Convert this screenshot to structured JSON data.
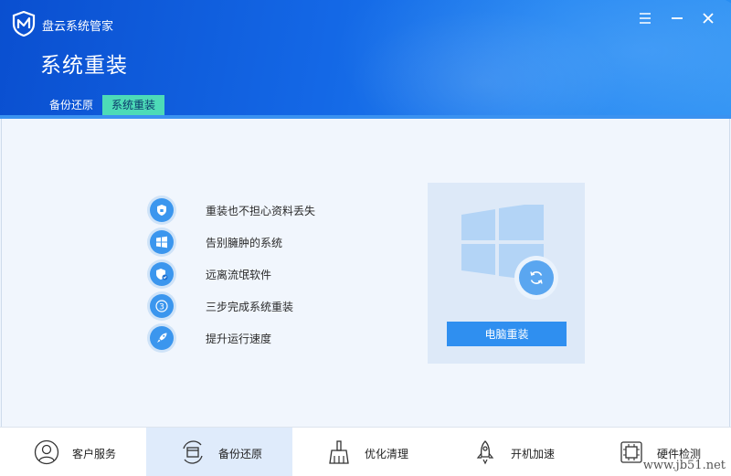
{
  "app": {
    "title": "盘云系统管家"
  },
  "header": {
    "page_title": "系统重装"
  },
  "window_controls": [
    "menu-icon",
    "minimize-icon",
    "close-icon"
  ],
  "tabs": [
    {
      "label": "备份还原",
      "active": false
    },
    {
      "label": "系统重装",
      "active": true
    }
  ],
  "features": [
    {
      "icon": "shield-icon",
      "label": "重装也不担心资料丢失"
    },
    {
      "icon": "windows-icon",
      "label": "告别臃肿的系统"
    },
    {
      "icon": "shield-check-icon",
      "label": "远离流氓软件"
    },
    {
      "icon": "number-3-icon",
      "label": "三步完成系统重装",
      "badge": "3"
    },
    {
      "icon": "rocket-icon",
      "label": "提升运行速度"
    }
  ],
  "panel": {
    "button_label": "电脑重装",
    "icon": "refresh-icon"
  },
  "bottom_nav": [
    {
      "icon": "user-icon",
      "label": "客户服务",
      "active": false
    },
    {
      "icon": "backup-icon",
      "label": "备份还原",
      "active": true
    },
    {
      "icon": "broom-icon",
      "label": "优化清理",
      "active": false
    },
    {
      "icon": "rocket-icon",
      "label": "开机加速",
      "active": false
    },
    {
      "icon": "chip-icon",
      "label": "硬件检测",
      "active": false
    }
  ],
  "watermark": "www.jb51.net",
  "colors": {
    "header": "#1468e6",
    "tab_active": "#4ddbb7",
    "button": "#2f8ff0",
    "icon": "#3b96ee"
  }
}
